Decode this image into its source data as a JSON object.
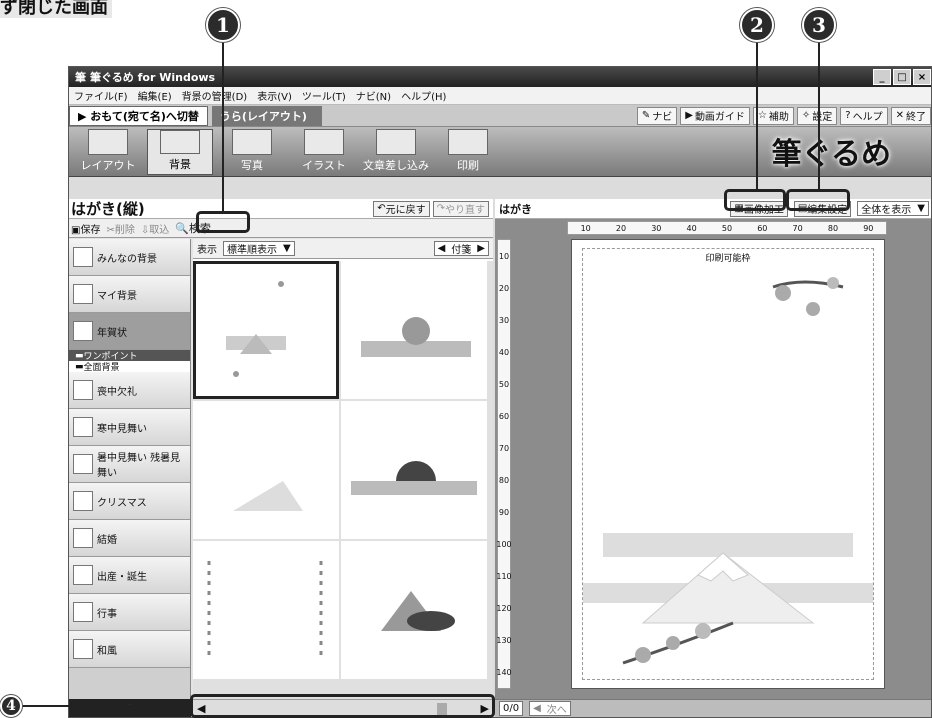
{
  "heading": "ず閉じた画面",
  "callouts": [
    "1",
    "2",
    "3",
    "4"
  ],
  "window": {
    "title": "筆ぐるめ for Windows",
    "controls": [
      "_",
      "□",
      "×"
    ]
  },
  "menu": [
    "ファイル(F)",
    "編集(E)",
    "背景の管理(D)",
    "表示(V)",
    "ツール(T)",
    "ナビ(N)",
    "ヘルプ(H)"
  ],
  "mode": {
    "front_tab": "▶ おもて(宛て名)へ切替",
    "back_tab": "うら(レイアウト)",
    "buttons": [
      "ナビ",
      "動画ガイド",
      "補助",
      "設定",
      "ヘルプ",
      "終了"
    ]
  },
  "tools": [
    "レイアウト",
    "背景",
    "写真",
    "イラスト",
    "文章差し込み",
    "印刷"
  ],
  "logo": "筆ぐるめ",
  "left": {
    "title": "はがき(縦)",
    "undo": "元に戻す",
    "redo": "やり直す",
    "save": "保存",
    "delete": "削除",
    "import": "取込",
    "search": "検索",
    "display_label": "表示",
    "sort": "標準順表示",
    "tag": "付箋",
    "categories": [
      "みんなの背景",
      "マイ背景",
      "年賀状",
      "ワンポイント",
      "全面背景",
      "喪中欠礼",
      "寒中見舞い",
      "暑中見舞い 残暑見舞い",
      "クリスマス",
      "結婚",
      "出産・誕生",
      "行事",
      "和風"
    ]
  },
  "right": {
    "title": "はがき",
    "image_edit": "画像加工",
    "edit_settings": "編集設定",
    "show_all": "全体を表示",
    "print_area": "印刷可能枠",
    "ruler_h": [
      "10",
      "20",
      "30",
      "40",
      "50",
      "60",
      "70",
      "80",
      "90"
    ],
    "ruler_v": [
      "10",
      "20",
      "30",
      "40",
      "50",
      "60",
      "70",
      "80",
      "90",
      "100",
      "110",
      "120",
      "130",
      "140"
    ],
    "page": "0/0",
    "next": "次へ"
  },
  "colors": {
    "window_bg": "#dcdcdc",
    "title_bg": "#222222",
    "canvas_bg": "#ffffff"
  }
}
